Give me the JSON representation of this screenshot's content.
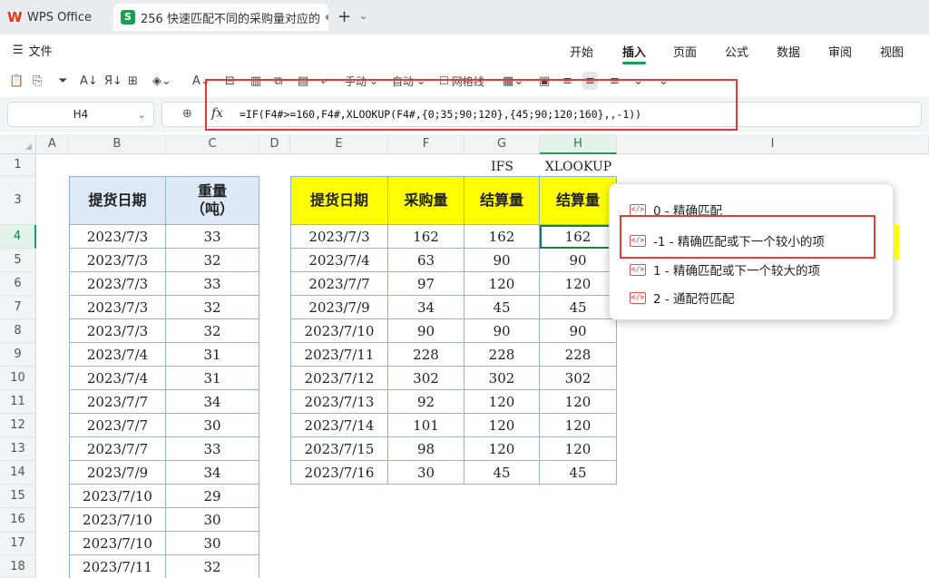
{
  "titlebar": {
    "app_tab": "WPS Office",
    "doc_tab": "256 快速匹配不同的采购量对应的",
    "doc_icon": "S"
  },
  "menu": {
    "file": "文件",
    "tabs": [
      "开始",
      "插入",
      "页面",
      "公式",
      "数据",
      "审阅",
      "视图"
    ],
    "active_tab": "插入"
  },
  "toolbar": {
    "manual": "手动",
    "auto": "自动",
    "gridlines": "网格线"
  },
  "formula_bar": {
    "cell_ref": "H4",
    "fx": "fx",
    "formula": "=IF(F4#>=160,F4#,XLOOKUP(F4#,{0;35;90;120},{45;90;120;160},,-1))"
  },
  "sheet": {
    "columns": [
      "A",
      "B",
      "C",
      "D",
      "E",
      "F",
      "G",
      "H",
      "I"
    ],
    "rows": [
      "1",
      "3",
      "4",
      "5",
      "6",
      "7",
      "8",
      "9",
      "10",
      "11",
      "12",
      "13",
      "14",
      "15",
      "16",
      "17",
      "18"
    ],
    "selected_col": "H",
    "selected_row": "4",
    "label_ifs": "IFS",
    "label_xlookup": "XLOOKUP",
    "left_table": {
      "headers": [
        "提货日期",
        "重量\n（吨）"
      ],
      "rows": [
        [
          "2023/7/3",
          "33"
        ],
        [
          "2023/7/3",
          "32"
        ],
        [
          "2023/7/3",
          "33"
        ],
        [
          "2023/7/3",
          "32"
        ],
        [
          "2023/7/3",
          "32"
        ],
        [
          "2023/7/4",
          "31"
        ],
        [
          "2023/7/4",
          "31"
        ],
        [
          "2023/7/7",
          "34"
        ],
        [
          "2023/7/7",
          "30"
        ],
        [
          "2023/7/7",
          "33"
        ],
        [
          "2023/7/9",
          "34"
        ],
        [
          "2023/7/10",
          "29"
        ],
        [
          "2023/7/10",
          "30"
        ],
        [
          "2023/7/10",
          "30"
        ],
        [
          "2023/7/11",
          "32"
        ]
      ]
    },
    "right_table": {
      "headers": [
        "提货日期",
        "采购量",
        "结算量",
        "结算量"
      ],
      "rows": [
        [
          "2023/7/3",
          "162",
          "162",
          "162"
        ],
        [
          "2023/7/4",
          "63",
          "90",
          "90"
        ],
        [
          "2023/7/7",
          "97",
          "120",
          "120"
        ],
        [
          "2023/7/9",
          "34",
          "45",
          "45"
        ],
        [
          "2023/7/10",
          "90",
          "90",
          "90"
        ],
        [
          "2023/7/11",
          "228",
          "228",
          "228"
        ],
        [
          "2023/7/12",
          "302",
          "302",
          "302"
        ],
        [
          "2023/7/13",
          "92",
          "120",
          "120"
        ],
        [
          "2023/7/14",
          "101",
          "120",
          "120"
        ],
        [
          "2023/7/15",
          "98",
          "120",
          "120"
        ],
        [
          "2023/7/16",
          "30",
          "45",
          "45"
        ]
      ]
    }
  },
  "dropdown": {
    "items": [
      "0 - 精确匹配",
      "-1 - 精确匹配或下一个较小的项",
      "1 - 精确匹配或下一个较大的项",
      "2 - 通配符匹配"
    ],
    "highlighted_index": 1
  },
  "colors": {
    "accent": "#1a9e55",
    "highlight_box": "#e53935",
    "header_yellow": "#ffff00",
    "header_blue": "#dde9f7"
  }
}
